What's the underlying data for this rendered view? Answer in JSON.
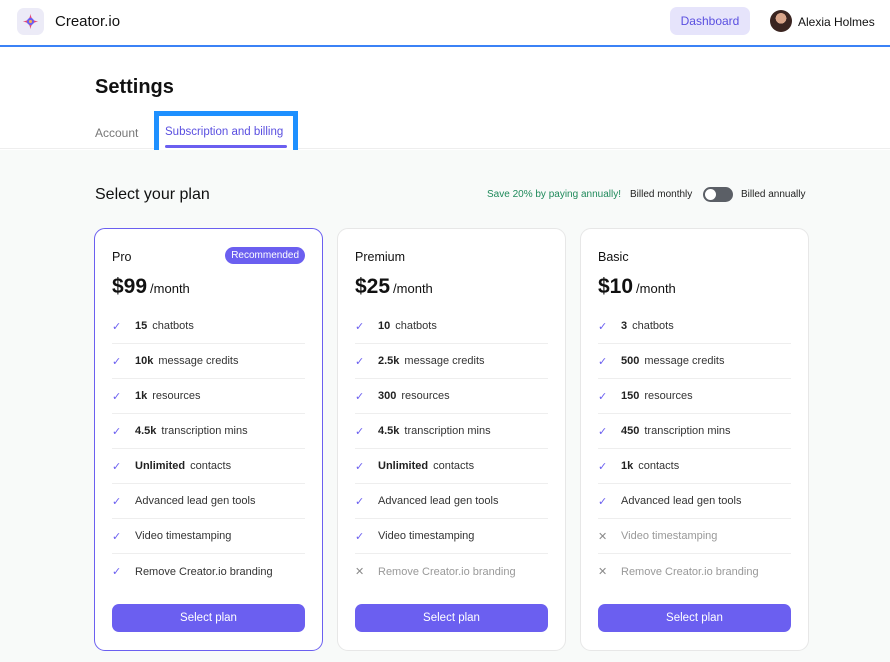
{
  "header": {
    "brand": "Creator.io",
    "dashboard_label": "Dashboard",
    "user_name": "Alexia Holmes"
  },
  "settings": {
    "title": "Settings",
    "tabs": [
      {
        "label": "Account",
        "active": false
      },
      {
        "label": "Subscription and billing",
        "active": true
      }
    ]
  },
  "plans_header": {
    "title": "Select your plan",
    "save_note": "Save 20% by paying annually!",
    "billed_monthly": "Billed monthly",
    "billed_annually": "Billed annually",
    "annual_billing_enabled": false
  },
  "plans": [
    {
      "name": "Pro",
      "badge": "Recommended",
      "price": "$99",
      "period": "/month",
      "cta": "Select plan",
      "features": [
        {
          "strong": "15",
          "text": "chatbots",
          "included": true
        },
        {
          "strong": "10k",
          "text": "message credits",
          "included": true
        },
        {
          "strong": "1k",
          "text": "resources",
          "included": true
        },
        {
          "strong": "4.5k",
          "text": "transcription mins",
          "included": true
        },
        {
          "strong": "Unlimited",
          "text": "contacts",
          "included": true
        },
        {
          "strong": "",
          "text": "Advanced lead gen tools",
          "included": true
        },
        {
          "strong": "",
          "text": "Video timestamping",
          "included": true
        },
        {
          "strong": "",
          "text": "Remove Creator.io branding",
          "included": true
        }
      ]
    },
    {
      "name": "Premium",
      "badge": "",
      "price": "$25",
      "period": "/month",
      "cta": "Select plan",
      "features": [
        {
          "strong": "10",
          "text": "chatbots",
          "included": true
        },
        {
          "strong": "2.5k",
          "text": "message credits",
          "included": true
        },
        {
          "strong": "300",
          "text": "resources",
          "included": true
        },
        {
          "strong": "4.5k",
          "text": "transcription mins",
          "included": true
        },
        {
          "strong": "Unlimited",
          "text": "contacts",
          "included": true
        },
        {
          "strong": "",
          "text": "Advanced lead gen tools",
          "included": true
        },
        {
          "strong": "",
          "text": "Video timestamping",
          "included": true
        },
        {
          "strong": "",
          "text": "Remove Creator.io branding",
          "included": false
        }
      ]
    },
    {
      "name": "Basic",
      "badge": "",
      "price": "$10",
      "period": "/month",
      "cta": "Select plan",
      "features": [
        {
          "strong": "3",
          "text": "chatbots",
          "included": true
        },
        {
          "strong": "500",
          "text": "message credits",
          "included": true
        },
        {
          "strong": "150",
          "text": "resources",
          "included": true
        },
        {
          "strong": "450",
          "text": "transcription mins",
          "included": true
        },
        {
          "strong": "1k",
          "text": "contacts",
          "included": true
        },
        {
          "strong": "",
          "text": "Advanced lead gen tools",
          "included": true
        },
        {
          "strong": "",
          "text": "Video timestamping",
          "included": false
        },
        {
          "strong": "",
          "text": "Remove Creator.io branding",
          "included": false
        }
      ]
    }
  ],
  "colors": {
    "accent": "#6b5ff0",
    "save_note": "#1f8a5b",
    "focus_outline": "#1e90ff"
  }
}
